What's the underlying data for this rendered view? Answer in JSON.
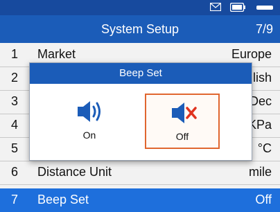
{
  "header": {
    "title": "System Setup",
    "page": "7/9"
  },
  "status_icons": [
    "envelope-icon",
    "battery-icon",
    "signal-icon"
  ],
  "rows": [
    {
      "num": "1",
      "label": "Market",
      "value": "Europe"
    },
    {
      "num": "2",
      "label": "",
      "value": "lish"
    },
    {
      "num": "3",
      "label": "",
      "value": "Dec"
    },
    {
      "num": "4",
      "label": "",
      "value": "KPa"
    },
    {
      "num": "5",
      "label": "",
      "value": "°C"
    },
    {
      "num": "6",
      "label": "Distance Unit",
      "value": "mile"
    },
    {
      "num": "7",
      "label": "Beep Set",
      "value": "Off"
    }
  ],
  "dialog": {
    "title": "Beep Set",
    "options": [
      {
        "label": "On",
        "icon": "speaker-on-icon"
      },
      {
        "label": "Off",
        "icon": "speaker-mute-icon",
        "selected": true
      }
    ]
  },
  "colors": {
    "header_bg": "#1b5cb8",
    "selected_row_bg": "#1e6fdc",
    "icon_blue": "#1b5cb8",
    "mute_x_red": "#e0331f",
    "selection_border": "#e0662f"
  }
}
